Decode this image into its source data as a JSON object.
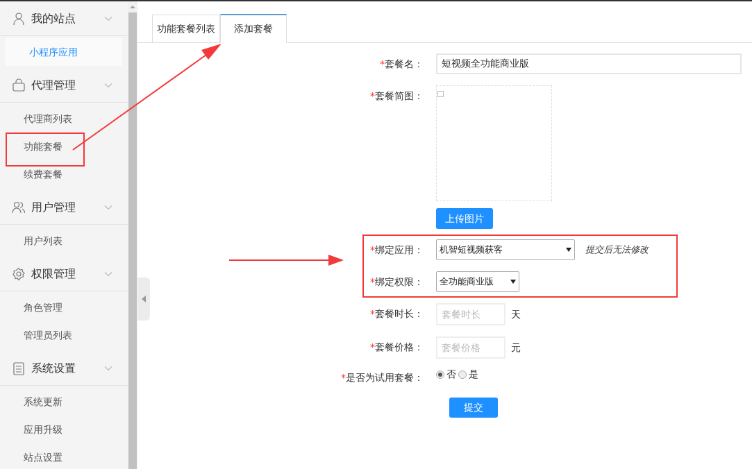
{
  "sidebar": {
    "groups": [
      {
        "label": "我的站点",
        "expanded": true,
        "items": [
          {
            "label": "小程序应用",
            "selected": true
          }
        ]
      },
      {
        "label": "代理管理",
        "expanded": true,
        "items": [
          {
            "label": "代理商列表",
            "selected": false
          },
          {
            "label": "功能套餐",
            "selected": false
          },
          {
            "label": "续费套餐",
            "selected": false
          }
        ]
      },
      {
        "label": "用户管理",
        "expanded": true,
        "items": [
          {
            "label": "用户列表",
            "selected": false
          }
        ]
      },
      {
        "label": "权限管理",
        "expanded": true,
        "items": [
          {
            "label": "角色管理",
            "selected": false
          },
          {
            "label": "管理员列表",
            "selected": false
          }
        ]
      },
      {
        "label": "系统设置",
        "expanded": true,
        "items": [
          {
            "label": "系统更新",
            "selected": false
          },
          {
            "label": "应用升级",
            "selected": false
          },
          {
            "label": "站点设置",
            "selected": false
          }
        ]
      }
    ]
  },
  "tabs": [
    {
      "label": "功能套餐列表",
      "selected": false
    },
    {
      "label": "添加套餐",
      "selected": true
    }
  ],
  "form": {
    "fields": [
      {
        "kind": "text",
        "mark": "*",
        "label": "套餐名：",
        "value": "短视频全功能商业版"
      },
      {
        "kind": "image",
        "mark": "*",
        "label": "套餐简图：",
        "button": "上传图片"
      },
      {
        "kind": "select",
        "mark": "*",
        "label": "绑定应用：",
        "value": "机智短视频获客",
        "hint": "提交后无法修改"
      },
      {
        "kind": "select",
        "mark": "*",
        "label": "绑定权限：",
        "value": "全功能商业版"
      },
      {
        "kind": "number",
        "mark": "*",
        "label": "套餐时长：",
        "placeholder": "套餐时长",
        "unit": "天"
      },
      {
        "kind": "number",
        "mark": "*",
        "label": "套餐价格：",
        "placeholder": "套餐价格",
        "unit": "元"
      },
      {
        "kind": "radio",
        "mark": "*",
        "label": "是否为试用套餐：",
        "options": [
          {
            "label": "否",
            "selected": true
          },
          {
            "label": "是",
            "selected": false
          }
        ]
      }
    ],
    "submit": "提交"
  }
}
